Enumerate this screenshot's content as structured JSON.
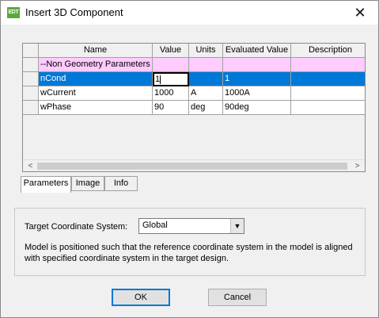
{
  "window": {
    "title": "Insert 3D Component",
    "app_icon_text": "EDT"
  },
  "table": {
    "columns": [
      "Name",
      "Value",
      "Units",
      "Evaluated Value",
      "Description"
    ],
    "group_row": {
      "name": "--Non Geometry Parameters"
    },
    "rows": [
      {
        "name": "nCond",
        "value": "1",
        "units": "",
        "evaluated": "1",
        "description": ""
      },
      {
        "name": "wCurrent",
        "value": "1000",
        "units": "A",
        "evaluated": "1000A",
        "description": ""
      },
      {
        "name": "wPhase",
        "value": "90",
        "units": "deg",
        "evaluated": "90deg",
        "description": ""
      }
    ]
  },
  "tabs": [
    "Parameters",
    "Image",
    "Info"
  ],
  "target": {
    "label": "Target Coordinate System:",
    "selected": "Global",
    "description": "Model is positioned such that the reference coordinate system in the model is aligned with specified coordinate system in the target design."
  },
  "buttons": {
    "ok": "OK",
    "cancel": "Cancel"
  }
}
